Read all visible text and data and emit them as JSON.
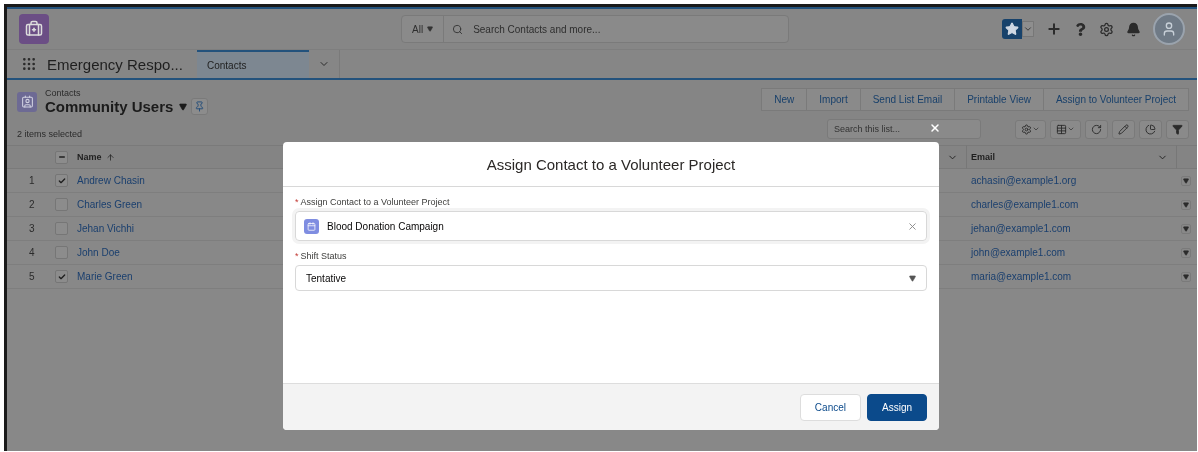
{
  "header": {
    "search": {
      "scope": "All",
      "placeholder": "Search Contacts and more..."
    }
  },
  "nav": {
    "app_name": "Emergency Respo...",
    "tabs": [
      {
        "label": "Contacts",
        "selected": true
      }
    ]
  },
  "list_view": {
    "object": "Contacts",
    "title": "Community Users",
    "selection_info": "2 items selected",
    "actions": [
      "New",
      "Import",
      "Send List Email",
      "Printable View",
      "Assign to Volunteer Project"
    ],
    "search_placeholder": "Search this list..."
  },
  "table": {
    "header_checkbox": {
      "indeterminate": true
    },
    "columns": [
      {
        "label": "Name",
        "sorted": true
      },
      {
        "label": "Email",
        "sorted": false
      }
    ],
    "rows": [
      {
        "number": "1",
        "selected": true,
        "name": "Andrew Chasin",
        "email": "achasin@example1.org"
      },
      {
        "number": "2",
        "selected": false,
        "name": "Charles Green",
        "email": "charles@example1.com"
      },
      {
        "number": "3",
        "selected": false,
        "name": "Jehan Vichhi",
        "email": "jehan@example1.com"
      },
      {
        "number": "4",
        "selected": false,
        "name": "John Doe",
        "email": "john@example1.com"
      },
      {
        "number": "5",
        "selected": true,
        "name": "Marie Green",
        "email": "maria@example1.com"
      }
    ]
  },
  "modal": {
    "title": "Assign Contact to a Volunteer Project",
    "fields": [
      {
        "kind": "lookup",
        "label": "Assign Contact to a Volunteer Project",
        "required_mark": "*",
        "value": "Blood Donation Campaign"
      },
      {
        "kind": "select",
        "label": "Shift Status",
        "required_mark": "*",
        "value": "Tentative"
      }
    ],
    "buttons": [
      {
        "label": "Cancel",
        "kind": "neutral"
      },
      {
        "label": "Assign",
        "kind": "brand"
      }
    ]
  }
}
